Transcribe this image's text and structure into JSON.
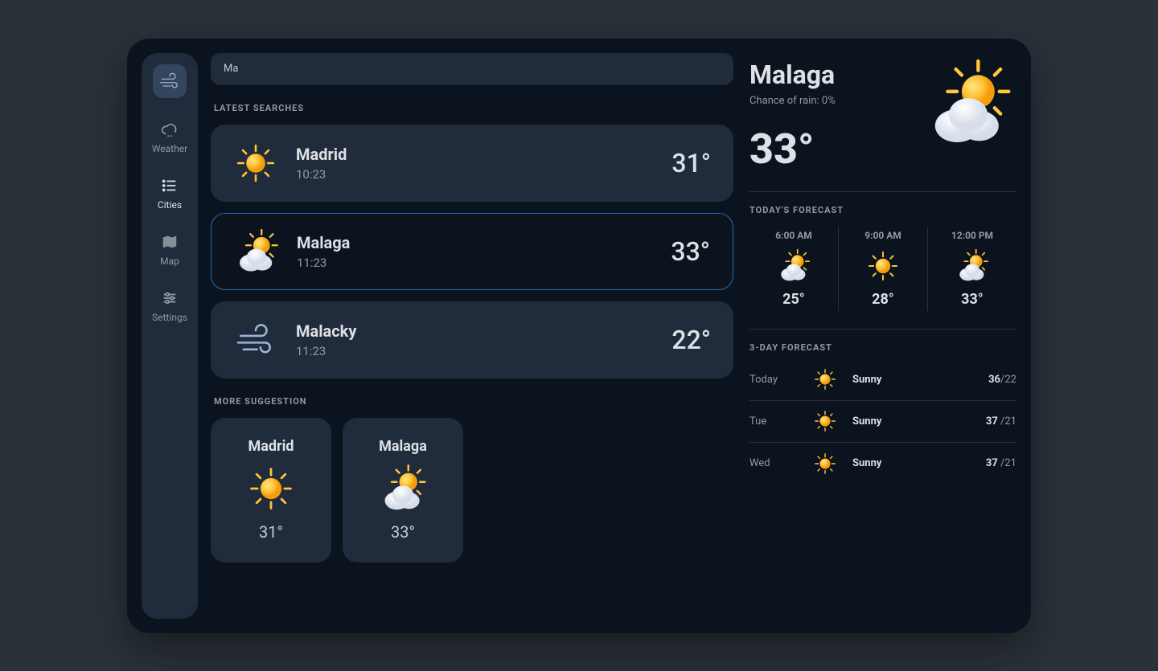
{
  "search": {
    "value": "Ma"
  },
  "sidebar": {
    "items": [
      {
        "label": "Weather",
        "icon": "cloud-rain-icon"
      },
      {
        "label": "Cities",
        "icon": "list-icon"
      },
      {
        "label": "Map",
        "icon": "map-icon"
      },
      {
        "label": "Settings",
        "icon": "sliders-icon"
      }
    ]
  },
  "sections": {
    "latest": "LATEST SEARCHES",
    "more": "MORE SUGGESTION",
    "today": "TODAY'S FORECAST",
    "threeDay": "3-DAY FORECAST"
  },
  "latest": [
    {
      "name": "Madrid",
      "time": "10:23",
      "temp": "31°",
      "icon": "sun"
    },
    {
      "name": "Malaga",
      "time": "11:23",
      "temp": "33°",
      "icon": "partly",
      "selected": true
    },
    {
      "name": "Malacky",
      "time": "11:23",
      "temp": "22°",
      "icon": "wind"
    }
  ],
  "suggestions": [
    {
      "name": "Madrid",
      "temp": "31°",
      "icon": "sun"
    },
    {
      "name": "Malaga",
      "temp": "33°",
      "icon": "partly"
    }
  ],
  "detail": {
    "city": "Malaga",
    "rain": "Chance of rain: 0%",
    "temp": "33°",
    "icon": "partly"
  },
  "hourly": [
    {
      "time": "6:00 AM",
      "temp": "25°",
      "icon": "partly"
    },
    {
      "time": "9:00 AM",
      "temp": "28°",
      "icon": "sun"
    },
    {
      "time": "12:00 PM",
      "temp": "33°",
      "icon": "partly"
    }
  ],
  "daily": [
    {
      "day": "Today",
      "icon": "sun",
      "cond": "Sunny",
      "hi": "36",
      "lo": "/22"
    },
    {
      "day": "Tue",
      "icon": "sun",
      "cond": "Sunny",
      "hi": "37 ",
      "lo": "/21"
    },
    {
      "day": "Wed",
      "icon": "sun",
      "cond": "Sunny",
      "hi": "37 ",
      "lo": "/21"
    }
  ]
}
